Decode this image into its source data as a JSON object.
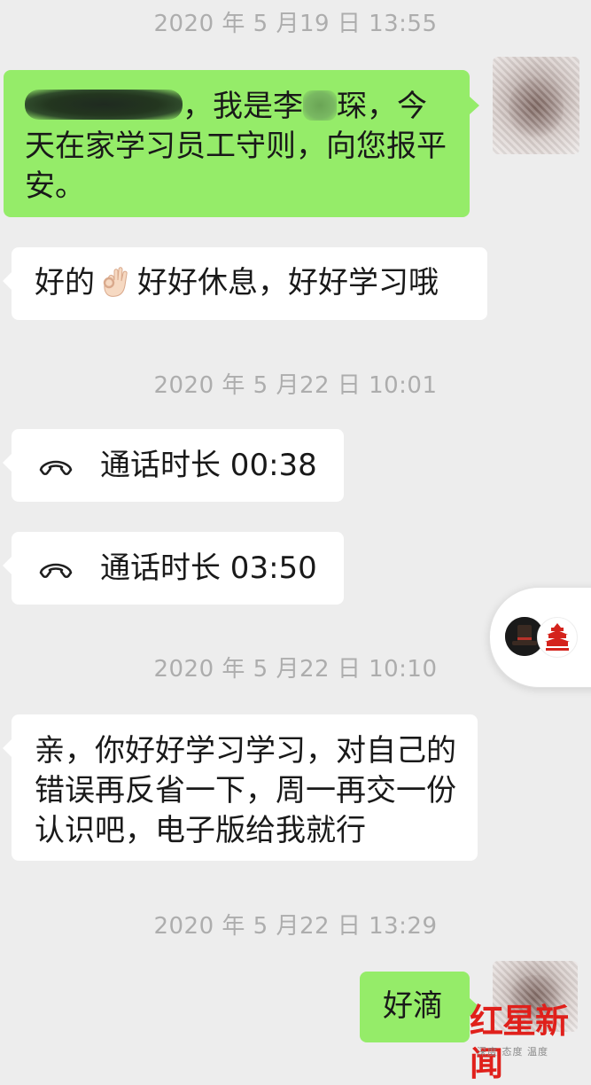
{
  "messages": {
    "ts1": "2020 年 5 月19 日 13:55",
    "m1": {
      "text_a": "，我是李",
      "text_b": "琛，今天在家学习员工守则，向您报平安。"
    },
    "m2": {
      "text_a": "好的",
      "emoji": "ok-hand-emoji",
      "text_b": "好好休息，好好学习哦"
    },
    "ts2": "2020 年 5 月22 日 10:01",
    "call1": {
      "icon": "phone-hangup-icon",
      "text": "通话时长 00:38"
    },
    "call2": {
      "icon": "phone-hangup-icon",
      "text": "通话时长 03:50"
    },
    "ts3": "2020 年 5 月22 日 10:10",
    "m3": {
      "text": "亲，你好好学习学习，对自己的错误再反省一下，周一再交一份认识吧，电子版给我就行"
    },
    "ts4": "2020 年 5 月22 日 13:29",
    "m4": {
      "text": "好滴"
    }
  },
  "watermark": {
    "main": "红星新闻",
    "sub": "深度 态度 温度"
  },
  "colors": {
    "background": "#ededed",
    "bubble_incoming": "#ffffff",
    "bubble_outgoing": "#95ec69",
    "timestamp": "#adadad",
    "watermark_red": "#e0201b"
  }
}
